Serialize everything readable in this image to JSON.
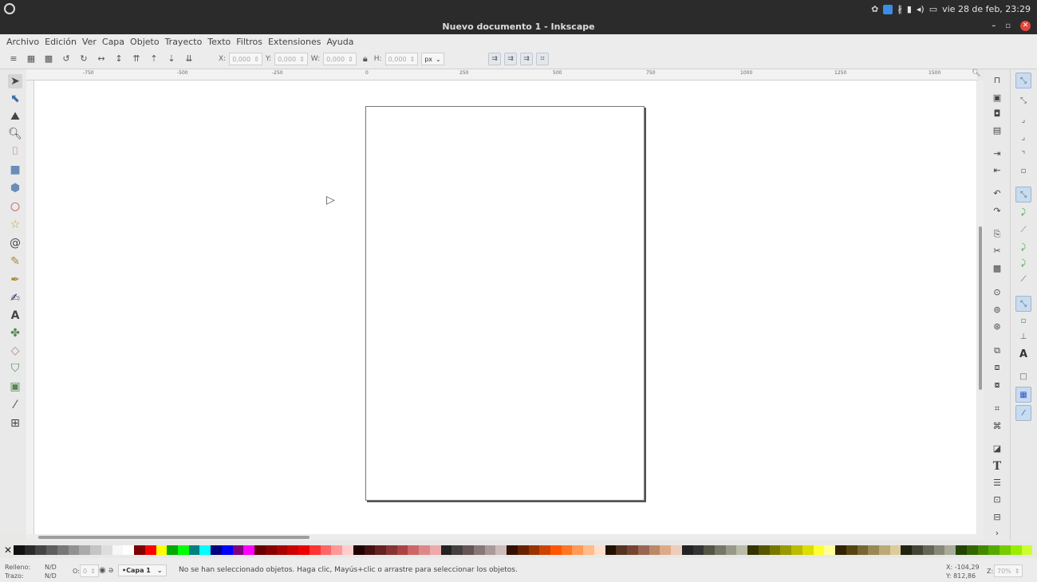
{
  "topbar": {
    "clock": "vie 28 de feb, 23:29",
    "tray_icons": [
      "shutter-icon",
      "skype-icon",
      "bluetooth-icon",
      "wifi-icon",
      "volume-icon",
      "battery-icon"
    ]
  },
  "window": {
    "title": "Nuevo documento 1 - Inkscape",
    "minimize": "–",
    "maximize": "▫",
    "close": "✕"
  },
  "menu": [
    "Archivo",
    "Edición",
    "Ver",
    "Capa",
    "Objeto",
    "Trayecto",
    "Texto",
    "Filtros",
    "Extensiones",
    "Ayuda"
  ],
  "toolbar": {
    "x_label": "X:",
    "x_value": "0,000",
    "y_label": "Y:",
    "y_value": "0,000",
    "w_label": "W:",
    "w_value": "0,000",
    "h_label": "H:",
    "h_value": "0,000",
    "unit": "px"
  },
  "ruler": {
    "h_labels": [
      "-750",
      "-500",
      "-250",
      "0",
      "250",
      "500",
      "750",
      "1000",
      "1250",
      "1500"
    ]
  },
  "status": {
    "fill_label": "Relleno:",
    "fill_value": "N/D",
    "stroke_label": "Trazo:",
    "stroke_value": "N/D",
    "opacity_label": "O:",
    "opacity_value": "0",
    "layer": "•Capa 1",
    "message": "No se han seleccionado objetos. Haga clic, Mayús+clic o arrastre para seleccionar los objetos.",
    "coord_x": "X: -104,29",
    "coord_y": "Y:  812,86",
    "zoom_label": "Z:",
    "zoom_value": "70%"
  },
  "palette_colors": [
    "#111111",
    "#2a2a2a",
    "#444444",
    "#5e5e5e",
    "#777777",
    "#919191",
    "#aaaaaa",
    "#c4c4c4",
    "#dddddd",
    "#f7f7f7",
    "#ffffff",
    "#800000",
    "#ff0000",
    "#ffff00",
    "#00aa00",
    "#00ff00",
    "#008080",
    "#00ffff",
    "#000080",
    "#0000ff",
    "#800080",
    "#ff00ff",
    "#660000",
    "#880000",
    "#aa0000",
    "#cc0000",
    "#ee0000",
    "#ff3333",
    "#ff6666",
    "#ff9999",
    "#ffcccc",
    "#220000",
    "#441111",
    "#662222",
    "#883333",
    "#aa4444",
    "#cc6666",
    "#dd8888",
    "#eeaaaa",
    "#222222",
    "#444040",
    "#665555",
    "#887777",
    "#aa9999",
    "#ccbbbb",
    "#331100",
    "#662200",
    "#993300",
    "#cc4400",
    "#ff5500",
    "#ff7722",
    "#ff9955",
    "#ffbb88",
    "#ffddcc",
    "#221100",
    "#553322",
    "#774433",
    "#996655",
    "#bb8866",
    "#ddaa88",
    "#eeccbb",
    "#222222",
    "#333333",
    "#555544",
    "#777766",
    "#999988",
    "#bbbbaa",
    "#333300",
    "#555500",
    "#777700",
    "#999900",
    "#bbbb00",
    "#dddd00",
    "#ffff33",
    "#ffff99",
    "#332200",
    "#554411",
    "#776633",
    "#998855",
    "#bbaa77",
    "#ddcc99",
    "#222211",
    "#444433",
    "#666655",
    "#888877",
    "#aaaa99",
    "#224400",
    "#336600",
    "#448800",
    "#55aa00",
    "#77cc00",
    "#99ee00",
    "#ccff33"
  ]
}
